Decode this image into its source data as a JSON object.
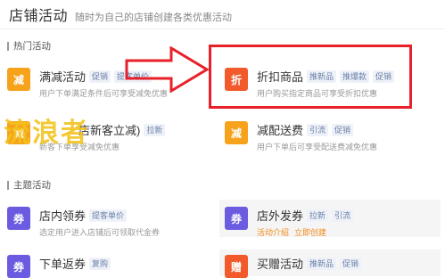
{
  "header": {
    "title": "店铺活动",
    "subtitle": "随时为自己的店铺创建各类优惠活动"
  },
  "sections": {
    "hot": "热门活动",
    "theme": "主题活动"
  },
  "cards": {
    "manjian": {
      "icon_char": "减",
      "icon_color": "#f7a21b",
      "title": "满减活动",
      "tags": [
        "促销",
        "提客单价"
      ],
      "desc": "用户下单满足条件后可享受减免优惠"
    },
    "zhekou": {
      "icon_char": "折",
      "icon_color": "#f25a2b",
      "title": "折扣商品",
      "tags": [
        "推新品",
        "推爆款",
        "促销"
      ],
      "desc": "用户购买指定商品可享受折扣优惠"
    },
    "xinkejianlie": {
      "icon_char": "减",
      "icon_color": "#f7a21b",
      "title": "(门店新客立减)",
      "title_visible": "店新客立减)",
      "tags": [
        "拉新"
      ],
      "desc": "新客下单享受减免优惠"
    },
    "jianpeisong": {
      "icon_char": "减",
      "icon_color": "#f7a21b",
      "title": "减配送费",
      "tags": [
        "引流",
        "促销"
      ],
      "desc": "用户下单后可享受配送费减免优惠"
    },
    "dianneiling": {
      "icon_char": "券",
      "icon_color": "#6a5be0",
      "title": "店内领券",
      "tags": [
        "提客单价"
      ],
      "desc": "选定用户进入店铺后可领取代金券"
    },
    "dianwaifa": {
      "icon_char": "券",
      "icon_color": "#6a5be0",
      "title": "店外发券",
      "tags": [
        "拉新",
        "引流"
      ],
      "links": [
        "活动介绍",
        "立即创建"
      ]
    },
    "xiadanfan": {
      "icon_char": "券",
      "icon_color": "#6a5be0",
      "title": "下单返券",
      "tags": [
        "复购"
      ]
    },
    "maizeng": {
      "icon_char": "赠",
      "icon_color": "#f25a2b",
      "title": "买赠活动",
      "tags": [
        "推新品",
        "促销"
      ]
    }
  },
  "watermark": "流浪者",
  "colors": {
    "highlight": "#e8202a",
    "arrow": "#e8202a",
    "link": "#f28c1b"
  }
}
